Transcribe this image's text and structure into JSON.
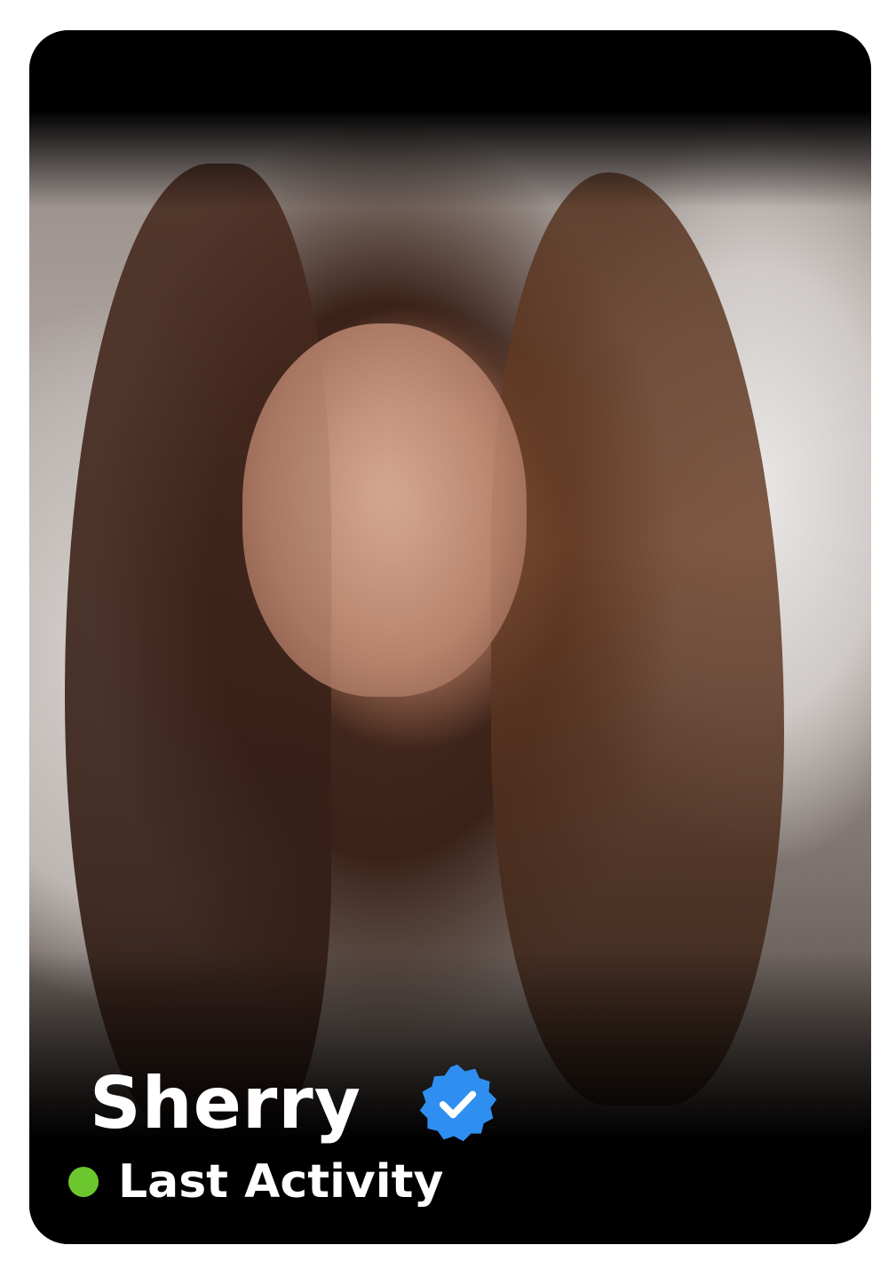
{
  "profile": {
    "name": "Sherry",
    "status": "Last Activity",
    "verified_icon": "verified-badge-icon",
    "status_icon": "online-dot-icon"
  },
  "colors": {
    "badge": "#2f8ff0",
    "online": "#6cc72e",
    "background": "#000000",
    "text": "#ffffff"
  }
}
